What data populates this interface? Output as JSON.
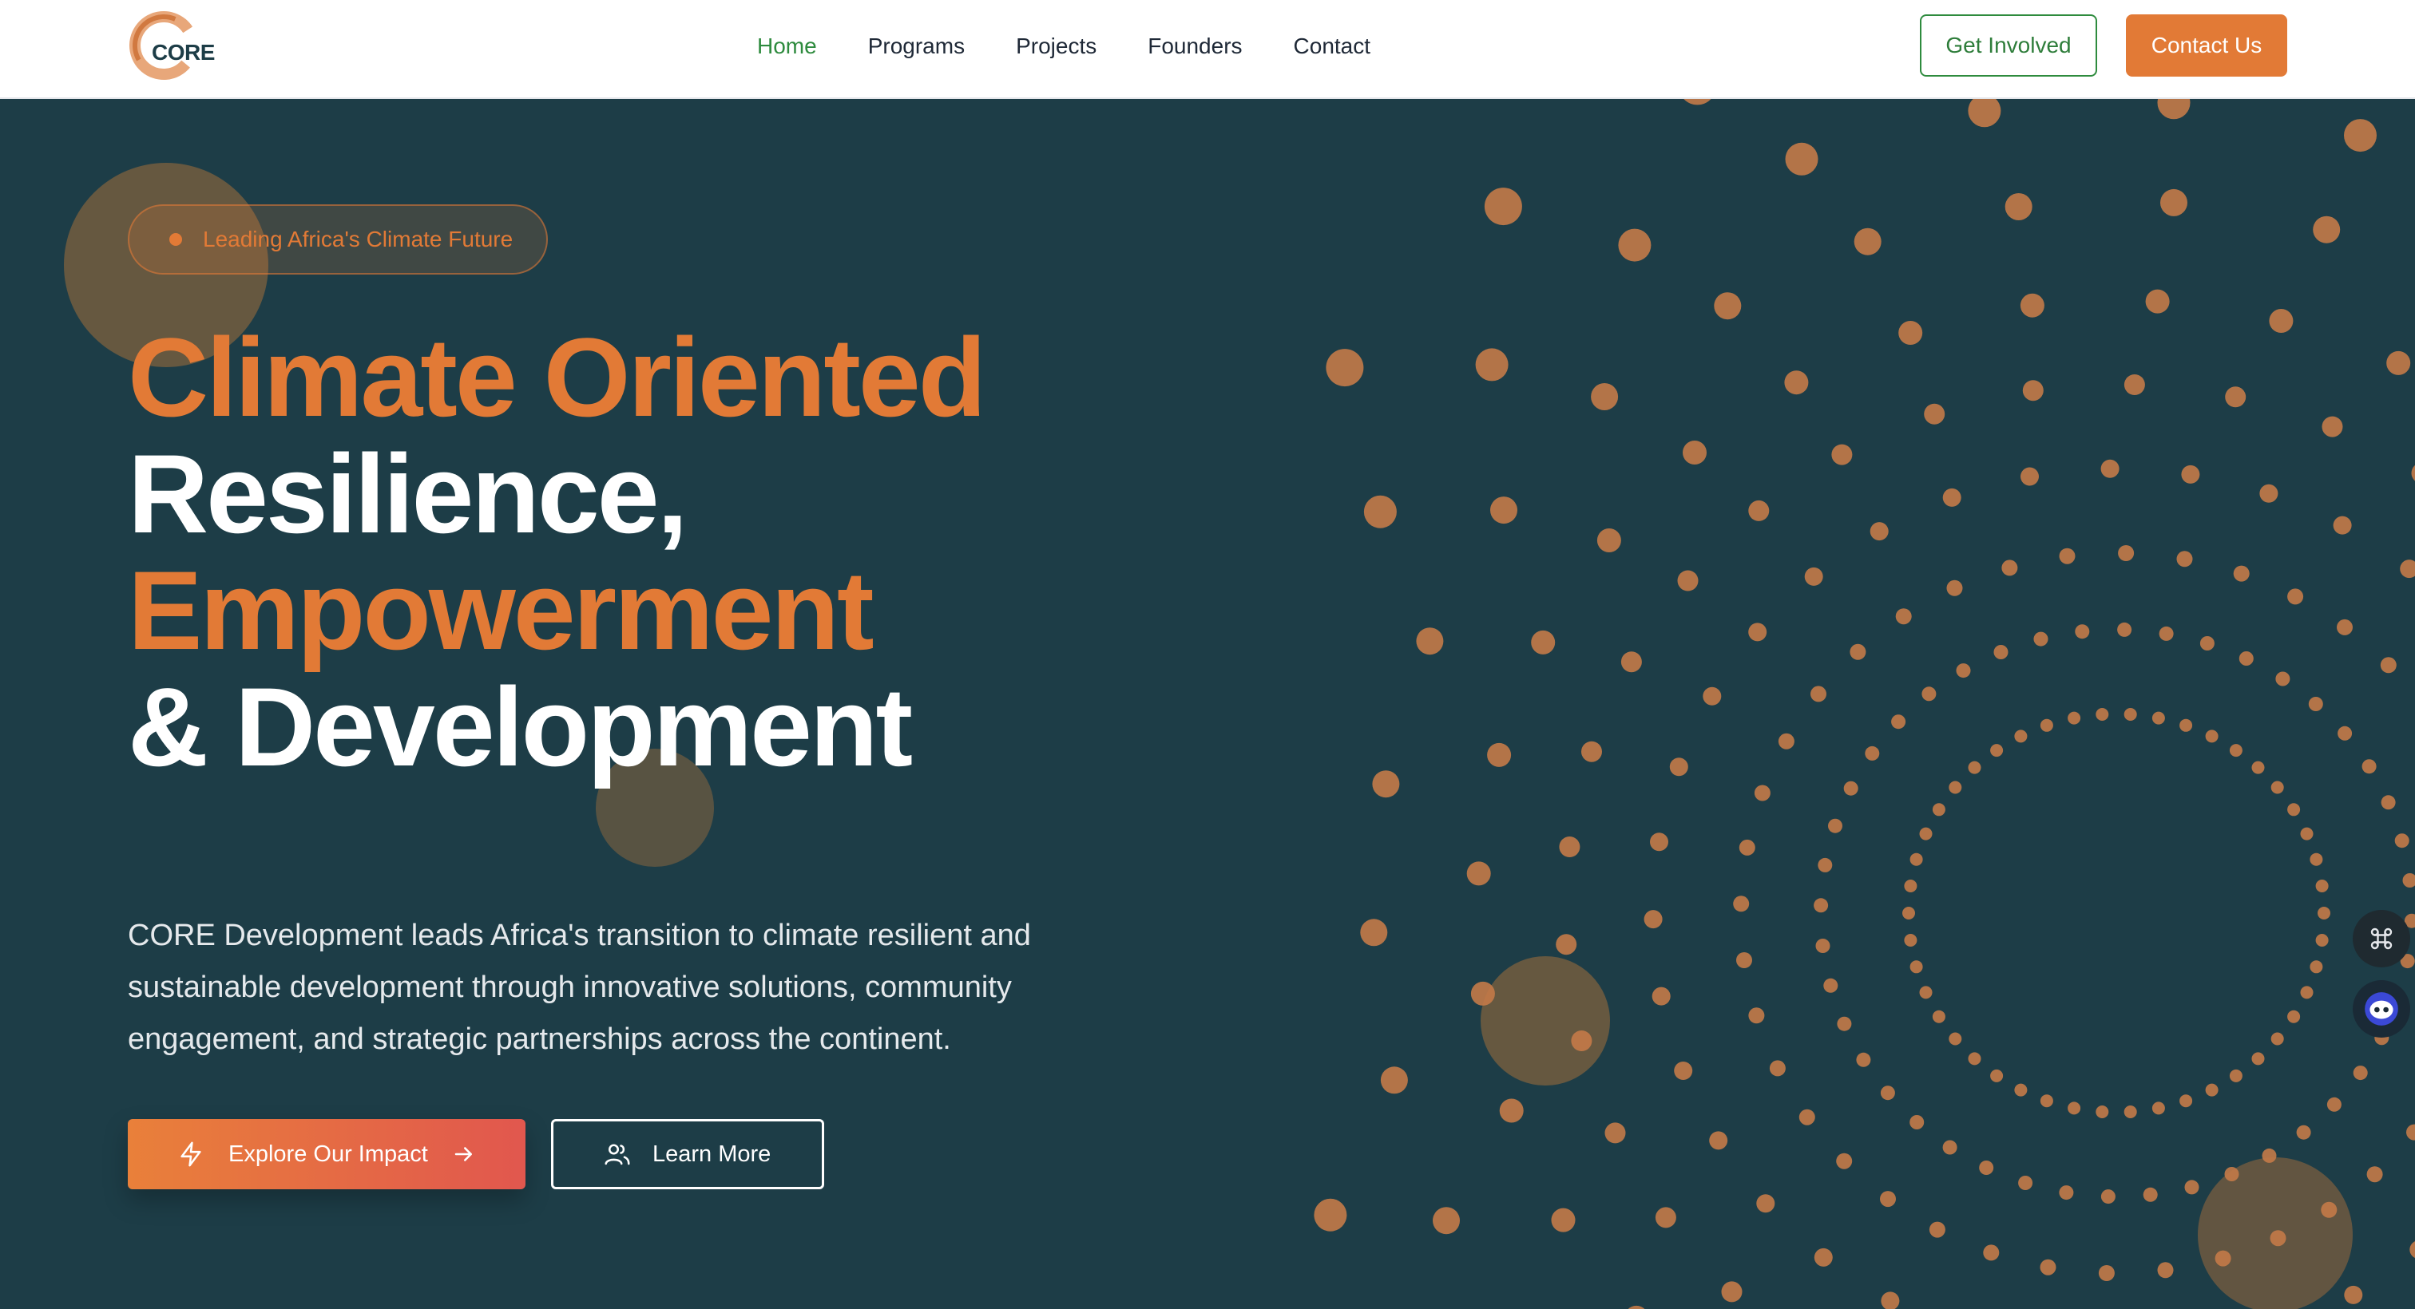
{
  "brand": {
    "logo_text": "CORE"
  },
  "nav": {
    "links": [
      {
        "label": "Home",
        "active": true
      },
      {
        "label": "Programs"
      },
      {
        "label": "Projects"
      },
      {
        "label": "Founders"
      },
      {
        "label": "Contact"
      }
    ],
    "get_involved": "Get Involved",
    "contact_us": "Contact Us"
  },
  "hero": {
    "badge": "Leading Africa's Climate Future",
    "headline": {
      "line1": "Climate Oriented",
      "line2": "Resilience,",
      "line3": "Empowerment",
      "line4": "& Development"
    },
    "description": "CORE Development leads Africa's transition to climate resilient and sustainable development through innovative solutions, community engagement, and strategic partnerships across the continent.",
    "primary_cta": "Explore Our Impact",
    "secondary_cta": "Learn More"
  },
  "colors": {
    "background": "#1d3d47",
    "accent": "#e27a36",
    "nav_active": "#2e8b3e"
  },
  "floating_buttons": [
    {
      "icon": "command-icon"
    },
    {
      "icon": "chat-bot-icon"
    }
  ]
}
